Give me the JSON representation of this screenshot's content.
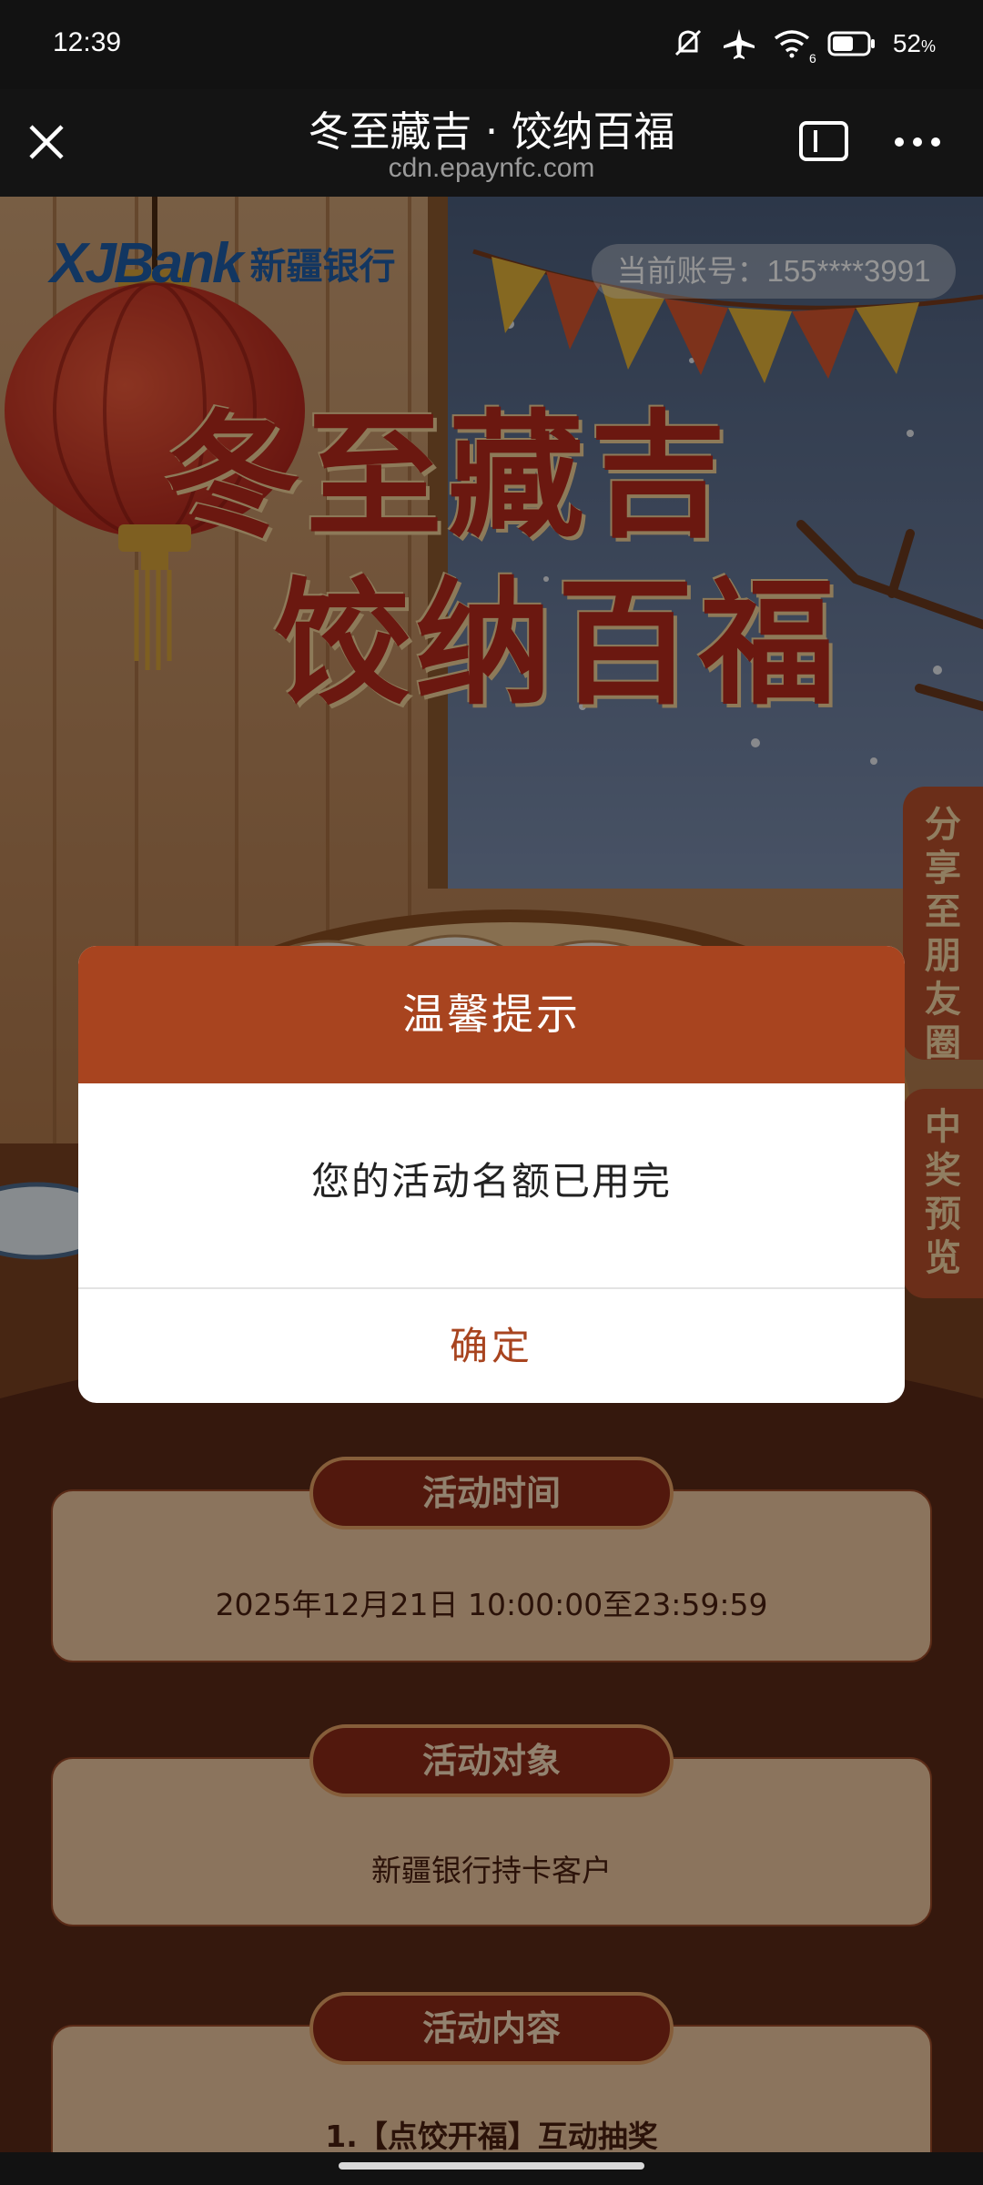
{
  "status_bar": {
    "time": "12:39",
    "battery_percent": "52",
    "battery_unit": "%",
    "network_label": "6",
    "icons": [
      "mute-icon",
      "airplane-icon",
      "wifi-icon",
      "battery-icon"
    ]
  },
  "nav": {
    "title": "冬至藏吉 · 饺纳百福",
    "url": "cdn.epaynfc.com",
    "icons": [
      "close-icon",
      "window-icon",
      "more-icon"
    ]
  },
  "poster": {
    "bank_logo_latin": "XJBank",
    "bank_logo_cn": "新疆银行",
    "account_label": "当前账号：155****3991",
    "title_line1": "冬至藏吉",
    "title_line2": "饺纳百福",
    "side_share": "分享至朋友圈",
    "side_prize": "中奖预览"
  },
  "info": {
    "time_label": "活动时间",
    "time_value": "2025年12月21日 10:00:00至23:59:59",
    "target_label": "活动对象",
    "target_value": "新疆银行持卡客户",
    "content_label": "活动内容",
    "content_line1": "1.【点饺开福】互动抽奖"
  },
  "dialog": {
    "title": "温馨提示",
    "message": "您的活动名额已用完",
    "confirm_label": "确定"
  },
  "colors": {
    "modal_header": "#a8441f",
    "modal_button_text": "#a8441f",
    "page_bg": "#5c2a18"
  }
}
